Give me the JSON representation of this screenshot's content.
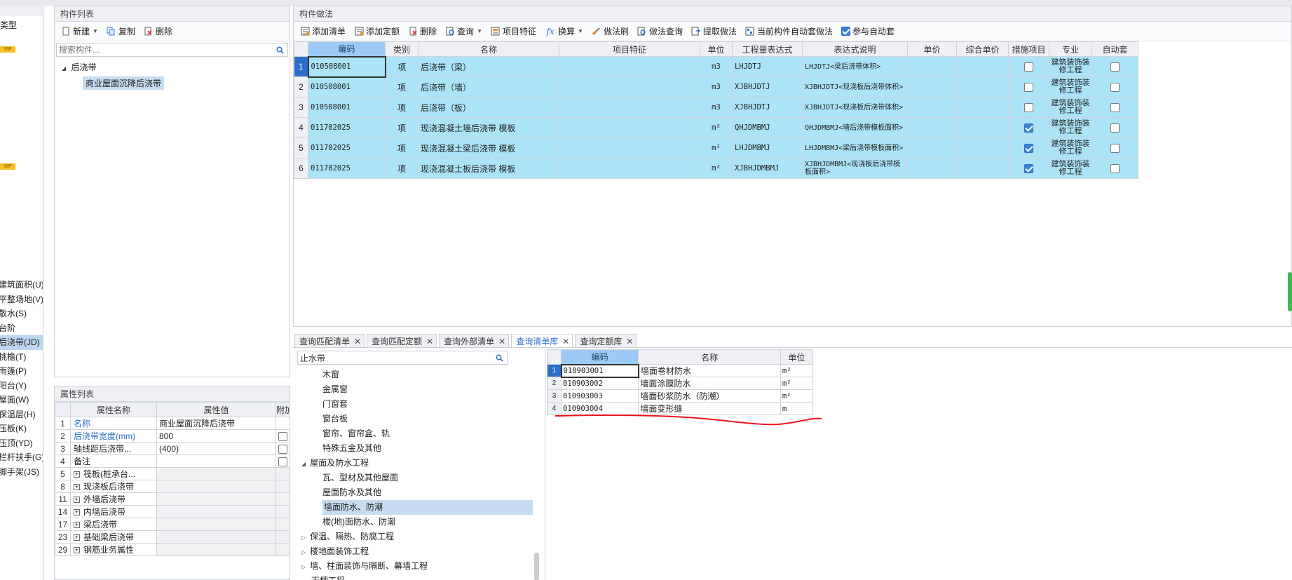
{
  "left_nav": {
    "type_label": "类型",
    "vip": "VIP",
    "items": [
      {
        "label": "建筑面积(U)",
        "selected": false
      },
      {
        "label": "平整场地(V)",
        "selected": false
      },
      {
        "label": "散水(S)",
        "selected": false
      },
      {
        "label": "台阶",
        "selected": false
      },
      {
        "label": "后浇带(JD)",
        "selected": true
      },
      {
        "label": "挑檐(T)",
        "selected": false
      },
      {
        "label": "雨篷(P)",
        "selected": false
      },
      {
        "label": "阳台(Y)",
        "selected": false
      },
      {
        "label": "屋面(W)",
        "selected": false
      },
      {
        "label": "保温层(H)",
        "selected": false
      },
      {
        "label": "压板(K)",
        "selected": false
      },
      {
        "label": "压顶(YD)",
        "selected": false
      },
      {
        "label": "栏杆扶手(G)",
        "selected": false
      },
      {
        "label": "脚手架(JS)",
        "selected": false
      }
    ]
  },
  "component_list": {
    "title": "构件列表",
    "toolbar": {
      "new": "新建",
      "copy": "复制",
      "delete": "删除"
    },
    "search_placeholder": "搜索构件...",
    "tree": {
      "root": "后浇带",
      "child": "商业屋面沉降后浇带"
    }
  },
  "properties": {
    "title": "属性列表",
    "headers": [
      "属性名称",
      "属性值",
      "附加"
    ],
    "rows": [
      {
        "num": "1",
        "name": "名称",
        "value": "商业屋面沉降后浇带",
        "blue": true,
        "check": false,
        "expand": false
      },
      {
        "num": "2",
        "name": "后浇带宽度(mm)",
        "value": "800",
        "blue": true,
        "check": true,
        "expand": false
      },
      {
        "num": "3",
        "name": "轴线距后浇带...",
        "value": "(400)",
        "blue": false,
        "check": true,
        "expand": false
      },
      {
        "num": "4",
        "name": "备注",
        "value": "",
        "blue": false,
        "check": true,
        "expand": false
      },
      {
        "num": "5",
        "name": "筏板(桩承台...",
        "value": "",
        "blue": false,
        "check": false,
        "expand": true
      },
      {
        "num": "8",
        "name": "现浇板后浇带",
        "value": "",
        "blue": false,
        "check": false,
        "expand": true
      },
      {
        "num": "11",
        "name": "外墙后浇带",
        "value": "",
        "blue": false,
        "check": false,
        "expand": true
      },
      {
        "num": "14",
        "name": "内墙后浇带",
        "value": "",
        "blue": false,
        "check": false,
        "expand": true
      },
      {
        "num": "17",
        "name": "梁后浇带",
        "value": "",
        "blue": false,
        "check": false,
        "expand": true
      },
      {
        "num": "23",
        "name": "基础梁后浇带",
        "value": "",
        "blue": false,
        "check": false,
        "expand": true
      },
      {
        "num": "29",
        "name": "钢筋业务属性",
        "value": "",
        "blue": false,
        "check": false,
        "expand": true
      }
    ]
  },
  "method": {
    "title": "构件做法",
    "toolbar": {
      "add_list": "添加清单",
      "add_quota": "添加定额",
      "delete": "删除",
      "query": "查询",
      "item_feature": "项目特征",
      "convert": "换算",
      "method_brush": "做法刷",
      "method_query": "做法查询",
      "extract_method": "提取做法",
      "auto_apply": "当前构件自动套做法",
      "join_auto": "参与自动套"
    },
    "headers": [
      "编码",
      "类别",
      "名称",
      "项目特征",
      "单位",
      "工程量表达式",
      "表达式说明",
      "单价",
      "综合单价",
      "措施项目",
      "专业",
      "自动套"
    ],
    "rows": [
      {
        "num": "1",
        "code": "010508001",
        "cat": "项",
        "name": "后浇带（梁）",
        "feature": "",
        "unit": "m3",
        "expr": "LHJDTJ",
        "desc": "LHJDTJ<梁后浇带体积>",
        "price": "",
        "total": "",
        "measure": false,
        "major": "建筑装饰装修工程",
        "auto": false
      },
      {
        "num": "2",
        "code": "010508001",
        "cat": "项",
        "name": "后浇带（墙）",
        "feature": "",
        "unit": "m3",
        "expr": "XJBHJDTJ",
        "desc": "XJBHJDTJ<现浇板后浇带体积>",
        "price": "",
        "total": "",
        "measure": false,
        "major": "建筑装饰装修工程",
        "auto": false
      },
      {
        "num": "3",
        "code": "010508001",
        "cat": "项",
        "name": "后浇带（板）",
        "feature": "",
        "unit": "m3",
        "expr": "XJBHJDTJ",
        "desc": "XJBHJDTJ<现浇板后浇带体积>",
        "price": "",
        "total": "",
        "measure": false,
        "major": "建筑装饰装修工程",
        "auto": false
      },
      {
        "num": "4",
        "code": "011702025",
        "cat": "项",
        "name": "现浇混凝土墙后浇带 模板",
        "feature": "",
        "unit": "m²",
        "expr": "QHJDMBMJ",
        "desc": "QHJDMBMJ<墙后浇带模板面积>",
        "price": "",
        "total": "",
        "measure": true,
        "major": "建筑装饰装修工程",
        "auto": false
      },
      {
        "num": "5",
        "code": "011702025",
        "cat": "项",
        "name": "现浇混凝土梁后浇带 模板",
        "feature": "",
        "unit": "m²",
        "expr": "LHJDMBMJ",
        "desc": "LHJDMBMJ<梁后浇带模板面积>",
        "price": "",
        "total": "",
        "measure": true,
        "major": "建筑装饰装修工程",
        "auto": false
      },
      {
        "num": "6",
        "code": "011702025",
        "cat": "项",
        "name": "现浇混凝土板后浇带 模板",
        "feature": "",
        "unit": "m²",
        "expr": "XJBHJDMBMJ",
        "desc": "XJBHJDMBMJ<现浇板后浇带模板面积>",
        "price": "",
        "total": "",
        "measure": true,
        "major": "建筑装饰装修工程",
        "auto": false
      }
    ]
  },
  "query": {
    "tabs": [
      {
        "label": "查询匹配清单",
        "active": false
      },
      {
        "label": "查询匹配定额",
        "active": false
      },
      {
        "label": "查询外部清单",
        "active": false
      },
      {
        "label": "查询清单库",
        "active": true
      },
      {
        "label": "查询定额库",
        "active": false
      }
    ],
    "search_value": "止水带",
    "tree": [
      {
        "label": "木窗",
        "level": 2,
        "toggle": "",
        "selected": false
      },
      {
        "label": "金属窗",
        "level": 2,
        "toggle": "",
        "selected": false
      },
      {
        "label": "门窗套",
        "level": 2,
        "toggle": "",
        "selected": false
      },
      {
        "label": "窗台板",
        "level": 2,
        "toggle": "",
        "selected": false
      },
      {
        "label": "窗帘、窗帘盒、轨",
        "level": 2,
        "toggle": "",
        "selected": false
      },
      {
        "label": "特殊五金及其他",
        "level": 2,
        "toggle": "",
        "selected": false
      },
      {
        "label": "屋面及防水工程",
        "level": 1,
        "toggle": "◢",
        "selected": false
      },
      {
        "label": "瓦、型材及其他屋面",
        "level": 2,
        "toggle": "",
        "selected": false
      },
      {
        "label": "屋面防水及其他",
        "level": 2,
        "toggle": "",
        "selected": false
      },
      {
        "label": "墙面防水、防潮",
        "level": 2,
        "toggle": "",
        "selected": true
      },
      {
        "label": "楼(地)面防水、防潮",
        "level": 2,
        "toggle": "",
        "selected": false
      },
      {
        "label": "保温、隔热、防腐工程",
        "level": 1,
        "toggle": "▷",
        "selected": false
      },
      {
        "label": "楼地面装饰工程",
        "level": 1,
        "toggle": "▷",
        "selected": false
      },
      {
        "label": "墙、柱面装饰与隔断、幕墙工程",
        "level": 1,
        "toggle": "▷",
        "selected": false
      },
      {
        "label": "天棚工程",
        "level": 1,
        "toggle": "",
        "selected": false
      }
    ],
    "result_headers": [
      "编码",
      "名称",
      "单位"
    ],
    "results": [
      {
        "num": "1",
        "code": "010903001",
        "name": "墙面卷材防水",
        "unit": "m²"
      },
      {
        "num": "2",
        "code": "010903002",
        "name": "墙面涂膜防水",
        "unit": "m²"
      },
      {
        "num": "3",
        "code": "010903003",
        "name": "墙面砂浆防水（防潮）",
        "unit": "m²"
      },
      {
        "num": "4",
        "code": "010903004",
        "name": "墙面变形缝",
        "unit": "m"
      }
    ]
  },
  "colors": {
    "row_highlight": "#abe3f7",
    "header_selected": "#9cc9f5",
    "annotation_red": "#e8141b",
    "accent_blue": "#2a6fc9"
  }
}
